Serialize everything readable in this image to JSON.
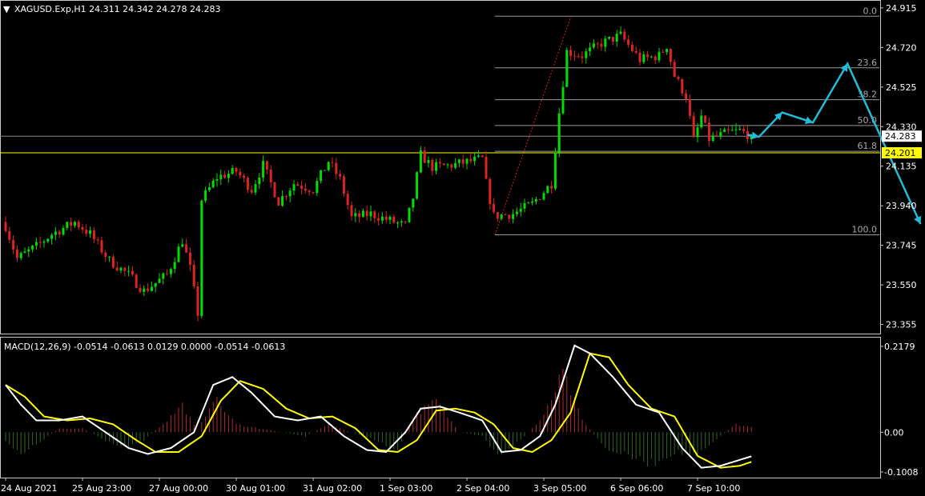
{
  "chart_data": {
    "type": "candlestick",
    "main": {
      "info": "XAGUSD.Exp,H1  24.311 24.342 24.278 24.283",
      "symbol_caret": "▼",
      "y_ticks": [
        24.915,
        24.72,
        24.525,
        24.33,
        24.135,
        23.94,
        23.745,
        23.55,
        23.355
      ],
      "ylim": [
        23.31,
        24.95
      ],
      "current_price": {
        "value": 24.283,
        "label": "24.283"
      },
      "horizontal_line": {
        "value": 24.201,
        "label": "24.201",
        "color": "#ffff00"
      },
      "fibonacci": {
        "high": 24.874,
        "low": 23.797,
        "levels": [
          {
            "ratio": 0.0,
            "label": "0.0"
          },
          {
            "ratio": 0.236,
            "label": "23.6"
          },
          {
            "ratio": 0.382,
            "label": "38.2"
          },
          {
            "ratio": 0.5,
            "label": "50.0"
          },
          {
            "ratio": 0.618,
            "label": "61.8"
          },
          {
            "ratio": 1.0,
            "label": "100.0"
          }
        ]
      },
      "forecast_path": [
        {
          "bar": 193,
          "price": 24.29
        },
        {
          "bar": 196,
          "price": 24.28
        },
        {
          "bar": 202,
          "price": 24.4
        },
        {
          "bar": 210,
          "price": 24.35
        },
        {
          "bar": 219,
          "price": 24.64
        },
        {
          "bar": 238,
          "price": 23.85
        }
      ],
      "bull_color": "#00dd00",
      "bear_color": "#dd2222",
      "forecast_color": "#22bcd6"
    },
    "bar_count": 195,
    "anchors": [
      {
        "bar": 0,
        "close": 23.84
      },
      {
        "bar": 3,
        "close": 23.68
      },
      {
        "bar": 8,
        "close": 23.74
      },
      {
        "bar": 12,
        "close": 23.8
      },
      {
        "bar": 18,
        "close": 23.86
      },
      {
        "bar": 22,
        "close": 23.8
      },
      {
        "bar": 27,
        "close": 23.67
      },
      {
        "bar": 32,
        "close": 23.6
      },
      {
        "bar": 36,
        "close": 23.52
      },
      {
        "bar": 42,
        "close": 23.6
      },
      {
        "bar": 46,
        "close": 23.77
      },
      {
        "bar": 48,
        "close": 23.63
      },
      {
        "bar": 50,
        "close": 23.41
      },
      {
        "bar": 51,
        "close": 23.97
      },
      {
        "bar": 55,
        "close": 24.08
      },
      {
        "bar": 60,
        "close": 24.11
      },
      {
        "bar": 64,
        "close": 24.02
      },
      {
        "bar": 67,
        "close": 24.14
      },
      {
        "bar": 71,
        "close": 23.96
      },
      {
        "bar": 75,
        "close": 24.05
      },
      {
        "bar": 80,
        "close": 24.02
      },
      {
        "bar": 84,
        "close": 24.16
      },
      {
        "bar": 87,
        "close": 24.07
      },
      {
        "bar": 90,
        "close": 23.88
      },
      {
        "bar": 95,
        "close": 23.9
      },
      {
        "bar": 101,
        "close": 23.86
      },
      {
        "bar": 104,
        "close": 23.84
      },
      {
        "bar": 106,
        "close": 23.98
      },
      {
        "bar": 108,
        "close": 24.19
      },
      {
        "bar": 111,
        "close": 24.13
      },
      {
        "bar": 116,
        "close": 24.14
      },
      {
        "bar": 121,
        "close": 24.16
      },
      {
        "bar": 124,
        "close": 24.17
      },
      {
        "bar": 125,
        "close": 24.05
      },
      {
        "bar": 127,
        "close": 23.89
      },
      {
        "bar": 132,
        "close": 23.9
      },
      {
        "bar": 137,
        "close": 23.95
      },
      {
        "bar": 142,
        "close": 24.05
      },
      {
        "bar": 144,
        "close": 24.4
      },
      {
        "bar": 146,
        "close": 24.7
      },
      {
        "bar": 150,
        "close": 24.68
      },
      {
        "bar": 155,
        "close": 24.74
      },
      {
        "bar": 160,
        "close": 24.78
      },
      {
        "bar": 165,
        "close": 24.66
      },
      {
        "bar": 170,
        "close": 24.68
      },
      {
        "bar": 172,
        "close": 24.73
      },
      {
        "bar": 174,
        "close": 24.58
      },
      {
        "bar": 177,
        "close": 24.48
      },
      {
        "bar": 179,
        "close": 24.26
      },
      {
        "bar": 181,
        "close": 24.38
      },
      {
        "bar": 183,
        "close": 24.27
      },
      {
        "bar": 188,
        "close": 24.3
      },
      {
        "bar": 191,
        "close": 24.31
      },
      {
        "bar": 194,
        "close": 24.283
      }
    ],
    "macd": {
      "info": "MACD(12,26,9) -0.0514 -0.0613 0.0129 0.0000 -0.0514 -0.0613",
      "y_ticks": [
        0.2179,
        0.0,
        -0.1008
      ],
      "y_tick_labels": [
        "0.2179",
        "0.00",
        "-0.1008"
      ],
      "ylim": [
        -0.115,
        0.24
      ],
      "bars": {
        "x": [
          0,
          4,
          8,
          14,
          20,
          26,
          32,
          36,
          42,
          46,
          50,
          54,
          60,
          66,
          72,
          78,
          84,
          90,
          96,
          102,
          106,
          112,
          118,
          124,
          128,
          134,
          140,
          145,
          150,
          156,
          162,
          168,
          174,
          180,
          186,
          190,
          194
        ],
        "y": [
          -0.02,
          -0.06,
          -0.03,
          0.01,
          0.01,
          -0.02,
          -0.04,
          -0.02,
          0.03,
          0.07,
          0.0,
          0.09,
          0.02,
          0.01,
          0.0,
          -0.01,
          0.02,
          0.0,
          -0.02,
          -0.05,
          0.04,
          0.08,
          0.0,
          -0.01,
          -0.06,
          -0.02,
          0.04,
          0.15,
          0.03,
          -0.04,
          -0.06,
          -0.08,
          -0.05,
          -0.06,
          -0.01,
          0.02,
          0.013
        ]
      },
      "main": {
        "x": [
          0,
          4,
          8,
          14,
          20,
          26,
          32,
          37,
          43,
          49,
          54,
          59,
          64,
          70,
          76,
          82,
          88,
          94,
          99,
          104,
          108,
          113,
          118,
          124,
          129,
          134,
          139,
          143,
          148,
          152,
          158,
          164,
          170,
          176,
          181,
          186,
          191,
          194
        ],
        "y": [
          0.12,
          0.07,
          0.03,
          0.03,
          0.04,
          0.0,
          -0.04,
          -0.055,
          -0.04,
          0.0,
          0.12,
          0.14,
          0.1,
          0.04,
          0.03,
          0.04,
          -0.01,
          -0.045,
          -0.05,
          0.0,
          0.06,
          0.065,
          0.05,
          0.03,
          -0.05,
          -0.045,
          -0.01,
          0.07,
          0.22,
          0.2,
          0.14,
          0.07,
          0.05,
          -0.04,
          -0.09,
          -0.085,
          -0.07,
          -0.061
        ]
      },
      "signal": {
        "x": [
          0,
          5,
          10,
          16,
          22,
          28,
          34,
          39,
          45,
          51,
          56,
          61,
          67,
          73,
          79,
          85,
          91,
          97,
          102,
          107,
          112,
          117,
          122,
          127,
          132,
          137,
          142,
          147,
          152,
          157,
          162,
          168,
          174,
          180,
          186,
          191,
          194
        ],
        "y": [
          0.12,
          0.09,
          0.04,
          0.03,
          0.035,
          0.02,
          -0.02,
          -0.05,
          -0.05,
          -0.01,
          0.08,
          0.13,
          0.11,
          0.06,
          0.035,
          0.04,
          0.01,
          -0.045,
          -0.05,
          -0.02,
          0.055,
          0.06,
          0.05,
          0.02,
          -0.04,
          -0.05,
          -0.02,
          0.05,
          0.2,
          0.19,
          0.12,
          0.06,
          0.04,
          -0.06,
          -0.09,
          -0.085,
          -0.075
        ]
      },
      "hist_pos_color": "#b52a2a",
      "hist_neg_color": "#2e6b22",
      "main_color": "#ffffff",
      "signal_color": "#ffff00"
    },
    "x_ticks": [
      {
        "bar": 0,
        "label": "24 Aug 2021"
      },
      {
        "bar": 20,
        "label": "25 Aug 23:00"
      },
      {
        "bar": 40,
        "label": "27 Aug 00:00"
      },
      {
        "bar": 60,
        "label": "30 Aug 01:00"
      },
      {
        "bar": 80,
        "label": "31 Aug 02:00"
      },
      {
        "bar": 100,
        "label": "1 Sep 03:00"
      },
      {
        "bar": 120,
        "label": "2 Sep 04:00"
      },
      {
        "bar": 140,
        "label": "3 Sep 05:00"
      },
      {
        "bar": 160,
        "label": "6 Sep 06:00"
      },
      {
        "bar": 180,
        "label": "7 Sep 10:00"
      }
    ]
  }
}
